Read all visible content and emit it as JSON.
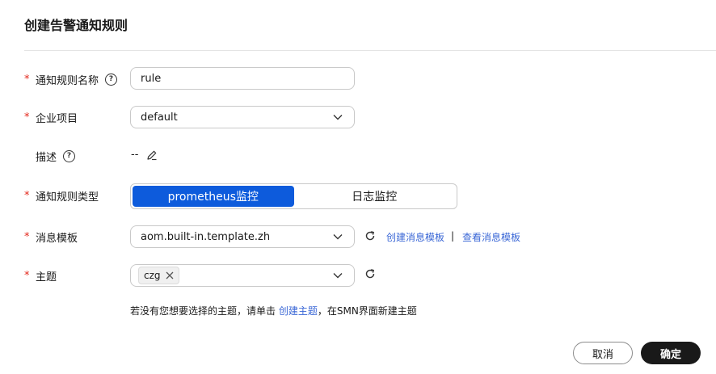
{
  "dialog": {
    "title": "创建告警通知规则"
  },
  "form": {
    "rule_name": {
      "label": "通知规则名称",
      "value": "rule",
      "required": true
    },
    "enterprise_project": {
      "label": "企业项目",
      "value": "default",
      "required": true
    },
    "description": {
      "label": "描述",
      "value": "--",
      "required": false
    },
    "rule_type": {
      "label": "通知规则类型",
      "options": [
        "prometheus监控",
        "日志监控"
      ],
      "selected": "prometheus监控",
      "required": true
    },
    "message_template": {
      "label": "消息模板",
      "value": "aom.built-in.template.zh",
      "required": true,
      "create_link": "创建消息模板",
      "separator": "|",
      "view_link": "查看消息模板"
    },
    "topic": {
      "label": "主题",
      "required": true,
      "tags": [
        "czg"
      ],
      "hint_prefix": "若没有您想要选择的主题，请单击 ",
      "hint_link": "创建主题",
      "hint_suffix": "，在SMN界面新建主题"
    }
  },
  "footer": {
    "cancel_label": "取消",
    "ok_label": "确定"
  },
  "colors": {
    "primary": "#0d5bdc",
    "link": "#3a67d6",
    "required": "#e3261a",
    "dark_button": "#191919"
  },
  "icons": [
    "help-icon",
    "chevron-down-icon",
    "edit-icon",
    "refresh-icon",
    "close-icon"
  ]
}
